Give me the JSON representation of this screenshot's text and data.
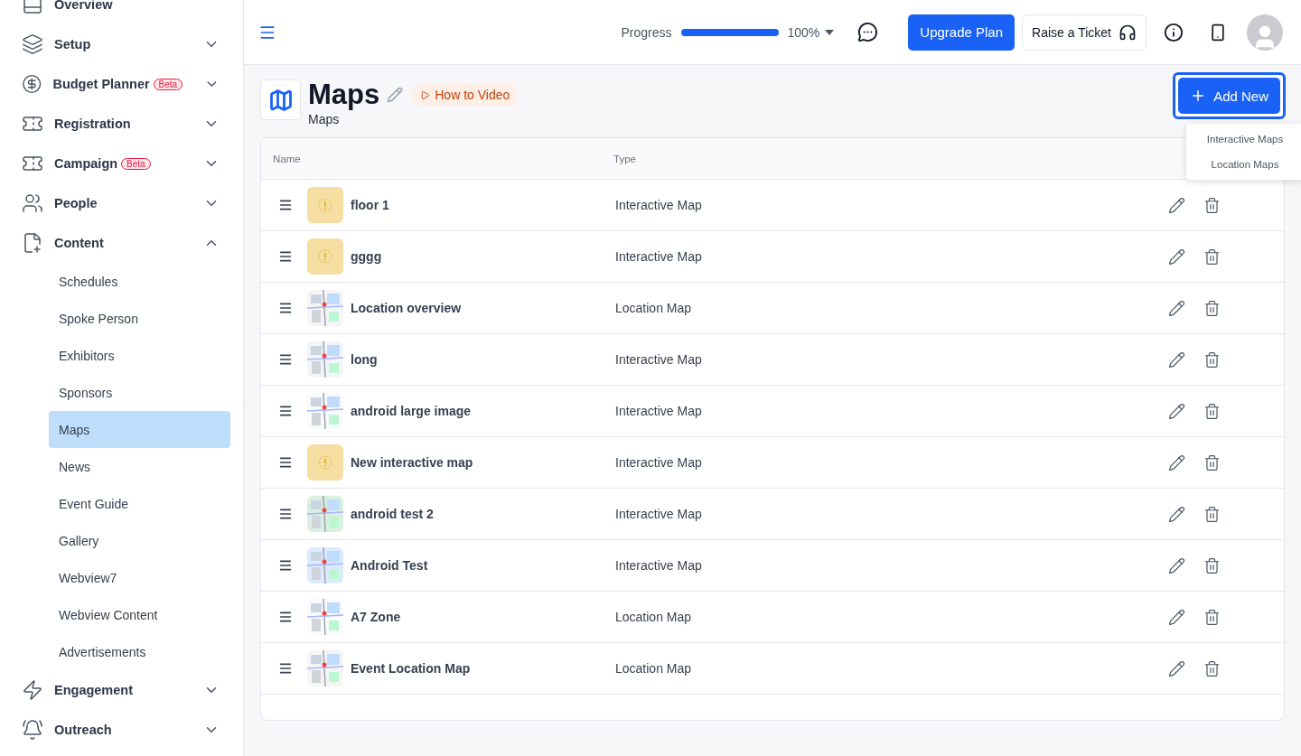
{
  "sidebar": {
    "items": [
      {
        "kind": "link",
        "label": "Overview"
      },
      {
        "kind": "group",
        "label": "Setup",
        "expanded": false
      },
      {
        "kind": "group",
        "label": "Budget Planner",
        "badge": "Beta",
        "expanded": false
      },
      {
        "kind": "group",
        "label": "Registration",
        "expanded": false
      },
      {
        "kind": "group",
        "label": "Campaign",
        "badge": "Beta",
        "expanded": false
      },
      {
        "kind": "group",
        "label": "People",
        "expanded": false
      },
      {
        "kind": "group",
        "label": "Content",
        "expanded": true,
        "children": [
          {
            "label": "Schedules",
            "selected": false
          },
          {
            "label": "Spoke Person",
            "selected": false
          },
          {
            "label": "Exhibitors",
            "selected": false
          },
          {
            "label": "Sponsors",
            "selected": false
          },
          {
            "label": "Maps",
            "selected": true
          },
          {
            "label": "News",
            "selected": false
          },
          {
            "label": "Event Guide",
            "selected": false
          },
          {
            "label": "Gallery",
            "selected": false
          },
          {
            "label": "Webview7",
            "selected": false
          },
          {
            "label": "Webview Content",
            "selected": false
          },
          {
            "label": "Advertisements",
            "selected": false
          }
        ]
      },
      {
        "kind": "group",
        "label": "Engagement",
        "expanded": false
      },
      {
        "kind": "group",
        "label": "Outreach",
        "expanded": false
      }
    ]
  },
  "topbar": {
    "progress": {
      "label": "Progress",
      "level": 1,
      "reading": "100%"
    },
    "upgrade_button": "Upgrade Plan",
    "ticket_button": "Raise a Ticket"
  },
  "page": {
    "title": "Maps",
    "subtitle": "Maps",
    "video_link": "How to Video",
    "add_button": "Add New",
    "add_menu": [
      "Interactive Maps",
      "Location Maps"
    ]
  },
  "table": {
    "columns": [
      "Name",
      "Type"
    ],
    "rows": [
      {
        "name": "floor 1",
        "type": "Interactive Map",
        "kind": "placeholder"
      },
      {
        "name": "gggg",
        "type": "Interactive Map",
        "kind": "placeholder"
      },
      {
        "name": "Location overview",
        "type": "Location Map",
        "kind": "picture"
      },
      {
        "name": "long",
        "type": "Interactive Map",
        "kind": "picture"
      },
      {
        "name": "android large image",
        "type": "Interactive Map",
        "kind": "picture"
      },
      {
        "name": "New interactive map",
        "type": "Interactive Map",
        "kind": "placeholder"
      },
      {
        "name": "android test 2",
        "type": "Interactive Map",
        "kind": "picture"
      },
      {
        "name": "Android Test",
        "type": "Interactive Map",
        "kind": "picture"
      },
      {
        "name": "A7 Zone",
        "type": "Location Map",
        "kind": "picture"
      },
      {
        "name": "Event Location Map",
        "type": "Location Map",
        "kind": "picture"
      }
    ]
  }
}
